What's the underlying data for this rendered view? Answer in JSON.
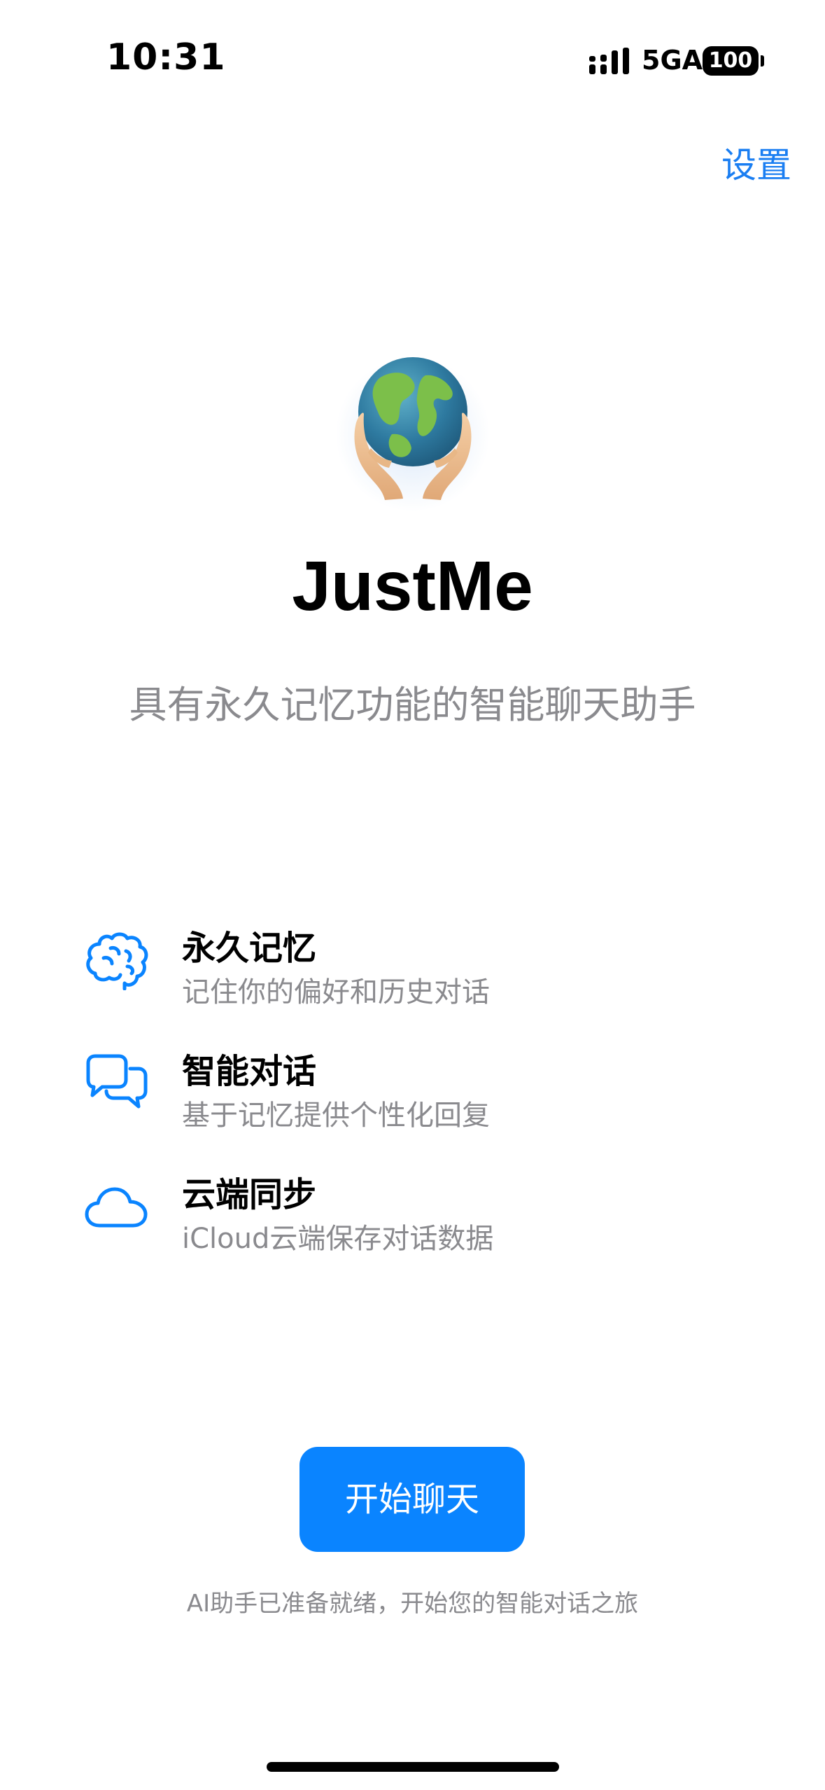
{
  "status_bar": {
    "time": "10:31",
    "network": "5GA",
    "battery": "100"
  },
  "header": {
    "settings_label": "设置"
  },
  "app": {
    "title": "JustMe",
    "subtitle": "具有永久记忆功能的智能聊天助手"
  },
  "features": [
    {
      "icon": "brain-icon",
      "title": "永久记忆",
      "description": "记住你的偏好和历史对话"
    },
    {
      "icon": "chat-bubbles-icon",
      "title": "智能对话",
      "description": "基于记忆提供个性化回复"
    },
    {
      "icon": "cloud-icon",
      "title": "云端同步",
      "description": "iCloud云端保存对话数据"
    }
  ],
  "primary_action": {
    "label": "开始聊天"
  },
  "footer": {
    "text": "AI助手已准备就绪，开始您的智能对话之旅"
  },
  "colors": {
    "accent": "#0a84ff",
    "link": "#1a7ef2",
    "secondary_text": "#8a8a8e"
  }
}
